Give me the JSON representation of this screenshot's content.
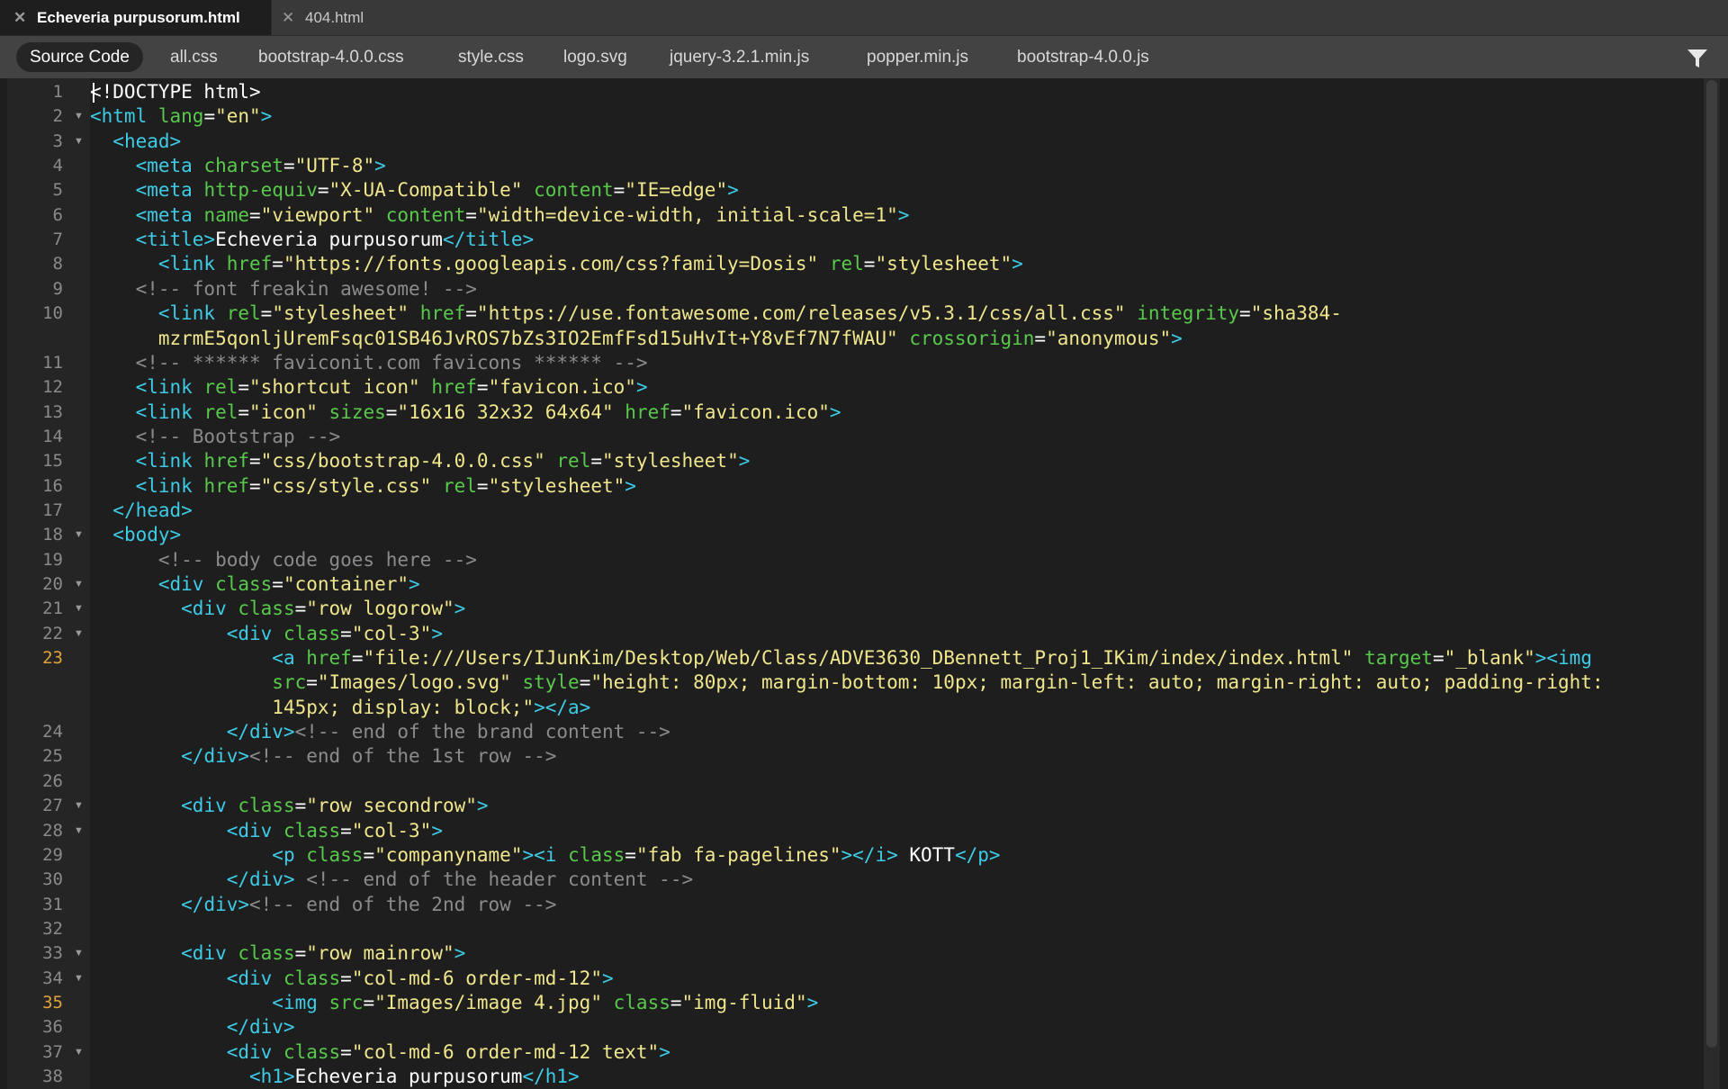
{
  "doc_tabs": [
    {
      "label": "Echeveria purpusorum.html",
      "active": true
    },
    {
      "label": "404.html",
      "active": false
    }
  ],
  "related_files": [
    "Source Code",
    "all.css",
    "bootstrap-4.0.0.css",
    "style.css",
    "logo.svg",
    "jquery-3.2.1.min.js",
    "popper.min.js",
    "bootstrap-4.0.0.js"
  ],
  "selected_file": "Source Code",
  "icons": {
    "close": "close-icon",
    "filter": "filter-icon",
    "fold": "fold-arrow-icon"
  },
  "colors": {
    "tag": "#3ecbe6",
    "attribute": "#59c94c",
    "value": "#f0e68c",
    "comment": "#8b8b8b",
    "text": "#ffffff",
    "highlight_line_number": "#e0a43b",
    "background": "#1e1e1e"
  },
  "highlighted_lines": [
    23,
    35
  ],
  "code_lines": [
    {
      "n": 1,
      "fold": false,
      "rows": [
        [
          [
            "t",
            "<!DOCTYPE html>"
          ]
        ]
      ]
    },
    {
      "n": 2,
      "fold": true,
      "rows": [
        [
          [
            "g",
            "<html "
          ],
          [
            "a",
            "lang"
          ],
          [
            "p",
            "="
          ],
          [
            "v",
            "\"en\""
          ],
          [
            "g",
            ">"
          ]
        ]
      ]
    },
    {
      "n": 3,
      "fold": true,
      "rows": [
        [
          [
            "t",
            "  "
          ],
          [
            "g",
            "<head>"
          ]
        ]
      ]
    },
    {
      "n": 4,
      "fold": false,
      "rows": [
        [
          [
            "t",
            "    "
          ],
          [
            "g",
            "<meta "
          ],
          [
            "a",
            "charset"
          ],
          [
            "p",
            "="
          ],
          [
            "v",
            "\"UTF-8\""
          ],
          [
            "g",
            ">"
          ]
        ]
      ]
    },
    {
      "n": 5,
      "fold": false,
      "rows": [
        [
          [
            "t",
            "    "
          ],
          [
            "g",
            "<meta "
          ],
          [
            "a",
            "http-equiv"
          ],
          [
            "p",
            "="
          ],
          [
            "v",
            "\"X-UA-Compatible\""
          ],
          [
            "t",
            " "
          ],
          [
            "a",
            "content"
          ],
          [
            "p",
            "="
          ],
          [
            "v",
            "\"IE=edge\""
          ],
          [
            "g",
            ">"
          ]
        ]
      ]
    },
    {
      "n": 6,
      "fold": false,
      "rows": [
        [
          [
            "t",
            "    "
          ],
          [
            "g",
            "<meta "
          ],
          [
            "a",
            "name"
          ],
          [
            "p",
            "="
          ],
          [
            "v",
            "\"viewport\""
          ],
          [
            "t",
            " "
          ],
          [
            "a",
            "content"
          ],
          [
            "p",
            "="
          ],
          [
            "v",
            "\"width=device-width, initial-scale=1\""
          ],
          [
            "g",
            ">"
          ]
        ]
      ]
    },
    {
      "n": 7,
      "fold": false,
      "rows": [
        [
          [
            "t",
            "    "
          ],
          [
            "g",
            "<title>"
          ],
          [
            "t",
            "Echeveria purpusorum"
          ],
          [
            "g",
            "</title>"
          ]
        ]
      ]
    },
    {
      "n": 8,
      "fold": false,
      "rows": [
        [
          [
            "t",
            "      "
          ],
          [
            "g",
            "<link "
          ],
          [
            "a",
            "href"
          ],
          [
            "p",
            "="
          ],
          [
            "v",
            "\"https://fonts.googleapis.com/css?family=Dosis\""
          ],
          [
            "t",
            " "
          ],
          [
            "a",
            "rel"
          ],
          [
            "p",
            "="
          ],
          [
            "v",
            "\"stylesheet\""
          ],
          [
            "g",
            ">"
          ]
        ]
      ]
    },
    {
      "n": 9,
      "fold": false,
      "rows": [
        [
          [
            "t",
            "    "
          ],
          [
            "c",
            "<!-- font freakin awesome! -->"
          ]
        ]
      ]
    },
    {
      "n": 10,
      "fold": false,
      "rows": [
        [
          [
            "t",
            "      "
          ],
          [
            "g",
            "<link "
          ],
          [
            "a",
            "rel"
          ],
          [
            "p",
            "="
          ],
          [
            "v",
            "\"stylesheet\""
          ],
          [
            "t",
            " "
          ],
          [
            "a",
            "href"
          ],
          [
            "p",
            "="
          ],
          [
            "v",
            "\"https://use.fontawesome.com/releases/v5.3.1/css/all.css\""
          ],
          [
            "t",
            " "
          ],
          [
            "a",
            "integrity"
          ],
          [
            "p",
            "="
          ],
          [
            "v",
            "\"sha384-"
          ]
        ],
        [
          [
            "t",
            "      "
          ],
          [
            "v",
            "mzrmE5qonljUremFsqc01SB46JvROS7bZs3IO2EmfFsd15uHvIt+Y8vEf7N7fWAU\""
          ],
          [
            "t",
            " "
          ],
          [
            "a",
            "crossorigin"
          ],
          [
            "p",
            "="
          ],
          [
            "v",
            "\"anonymous\""
          ],
          [
            "g",
            ">"
          ]
        ]
      ]
    },
    {
      "n": 11,
      "fold": false,
      "rows": [
        [
          [
            "t",
            "    "
          ],
          [
            "c",
            "<!-- ****** faviconit.com favicons ****** -->"
          ]
        ]
      ]
    },
    {
      "n": 12,
      "fold": false,
      "rows": [
        [
          [
            "t",
            "    "
          ],
          [
            "g",
            "<link "
          ],
          [
            "a",
            "rel"
          ],
          [
            "p",
            "="
          ],
          [
            "v",
            "\"shortcut icon\""
          ],
          [
            "t",
            " "
          ],
          [
            "a",
            "href"
          ],
          [
            "p",
            "="
          ],
          [
            "v",
            "\"favicon.ico\""
          ],
          [
            "g",
            ">"
          ]
        ]
      ]
    },
    {
      "n": 13,
      "fold": false,
      "rows": [
        [
          [
            "t",
            "    "
          ],
          [
            "g",
            "<link "
          ],
          [
            "a",
            "rel"
          ],
          [
            "p",
            "="
          ],
          [
            "v",
            "\"icon\""
          ],
          [
            "t",
            " "
          ],
          [
            "a",
            "sizes"
          ],
          [
            "p",
            "="
          ],
          [
            "v",
            "\"16x16 32x32 64x64\""
          ],
          [
            "t",
            " "
          ],
          [
            "a",
            "href"
          ],
          [
            "p",
            "="
          ],
          [
            "v",
            "\"favicon.ico\""
          ],
          [
            "g",
            ">"
          ]
        ]
      ]
    },
    {
      "n": 14,
      "fold": false,
      "rows": [
        [
          [
            "t",
            "    "
          ],
          [
            "c",
            "<!-- Bootstrap -->"
          ]
        ]
      ]
    },
    {
      "n": 15,
      "fold": false,
      "rows": [
        [
          [
            "t",
            "    "
          ],
          [
            "g",
            "<link "
          ],
          [
            "a",
            "href"
          ],
          [
            "p",
            "="
          ],
          [
            "v",
            "\"css/bootstrap-4.0.0.css\""
          ],
          [
            "t",
            " "
          ],
          [
            "a",
            "rel"
          ],
          [
            "p",
            "="
          ],
          [
            "v",
            "\"stylesheet\""
          ],
          [
            "g",
            ">"
          ]
        ]
      ]
    },
    {
      "n": 16,
      "fold": false,
      "rows": [
        [
          [
            "t",
            "    "
          ],
          [
            "g",
            "<link "
          ],
          [
            "a",
            "href"
          ],
          [
            "p",
            "="
          ],
          [
            "v",
            "\"css/style.css\""
          ],
          [
            "t",
            " "
          ],
          [
            "a",
            "rel"
          ],
          [
            "p",
            "="
          ],
          [
            "v",
            "\"stylesheet\""
          ],
          [
            "g",
            ">"
          ]
        ]
      ]
    },
    {
      "n": 17,
      "fold": false,
      "rows": [
        [
          [
            "t",
            "  "
          ],
          [
            "g",
            "</head>"
          ]
        ]
      ]
    },
    {
      "n": 18,
      "fold": true,
      "rows": [
        [
          [
            "t",
            "  "
          ],
          [
            "g",
            "<body>"
          ]
        ]
      ]
    },
    {
      "n": 19,
      "fold": false,
      "rows": [
        [
          [
            "t",
            "      "
          ],
          [
            "c",
            "<!-- body code goes here -->"
          ]
        ]
      ]
    },
    {
      "n": 20,
      "fold": true,
      "rows": [
        [
          [
            "t",
            "      "
          ],
          [
            "g",
            "<div "
          ],
          [
            "a",
            "class"
          ],
          [
            "p",
            "="
          ],
          [
            "v",
            "\"container\""
          ],
          [
            "g",
            ">"
          ]
        ]
      ]
    },
    {
      "n": 21,
      "fold": true,
      "rows": [
        [
          [
            "t",
            "        "
          ],
          [
            "g",
            "<div "
          ],
          [
            "a",
            "class"
          ],
          [
            "p",
            "="
          ],
          [
            "v",
            "\"row logorow\""
          ],
          [
            "g",
            ">"
          ]
        ]
      ]
    },
    {
      "n": 22,
      "fold": true,
      "rows": [
        [
          [
            "t",
            "            "
          ],
          [
            "g",
            "<div "
          ],
          [
            "a",
            "class"
          ],
          [
            "p",
            "="
          ],
          [
            "v",
            "\"col-3\""
          ],
          [
            "g",
            ">"
          ]
        ]
      ]
    },
    {
      "n": 23,
      "fold": false,
      "rows": [
        [
          [
            "t",
            "                "
          ],
          [
            "g",
            "<a "
          ],
          [
            "a",
            "href"
          ],
          [
            "p",
            "="
          ],
          [
            "v",
            "\"file:///Users/IJunKim/Desktop/Web/Class/ADVE3630_DBennett_Proj1_IKim/index/index.html\""
          ],
          [
            "t",
            " "
          ],
          [
            "a",
            "target"
          ],
          [
            "p",
            "="
          ],
          [
            "v",
            "\"_blank\""
          ],
          [
            "g",
            "><img"
          ]
        ],
        [
          [
            "t",
            "                "
          ],
          [
            "a",
            "src"
          ],
          [
            "p",
            "="
          ],
          [
            "v",
            "\"Images/logo.svg\""
          ],
          [
            "t",
            " "
          ],
          [
            "a",
            "style"
          ],
          [
            "p",
            "="
          ],
          [
            "v",
            "\"height: 80px; margin-bottom: 10px; margin-left: auto; margin-right: auto; padding-right:"
          ]
        ],
        [
          [
            "t",
            "                "
          ],
          [
            "v",
            "145px; display: block;\""
          ],
          [
            "g",
            "></a>"
          ]
        ]
      ]
    },
    {
      "n": 24,
      "fold": false,
      "rows": [
        [
          [
            "t",
            "            "
          ],
          [
            "g",
            "</div>"
          ],
          [
            "c",
            "<!-- end of the brand content -->"
          ]
        ]
      ]
    },
    {
      "n": 25,
      "fold": false,
      "rows": [
        [
          [
            "t",
            "        "
          ],
          [
            "g",
            "</div>"
          ],
          [
            "c",
            "<!-- end of the 1st row -->"
          ]
        ]
      ]
    },
    {
      "n": 26,
      "fold": false,
      "rows": [
        [
          [
            "t",
            ""
          ]
        ]
      ]
    },
    {
      "n": 27,
      "fold": true,
      "rows": [
        [
          [
            "t",
            "        "
          ],
          [
            "g",
            "<div "
          ],
          [
            "a",
            "class"
          ],
          [
            "p",
            "="
          ],
          [
            "v",
            "\"row secondrow\""
          ],
          [
            "g",
            ">"
          ]
        ]
      ]
    },
    {
      "n": 28,
      "fold": true,
      "rows": [
        [
          [
            "t",
            "            "
          ],
          [
            "g",
            "<div "
          ],
          [
            "a",
            "class"
          ],
          [
            "p",
            "="
          ],
          [
            "v",
            "\"col-3\""
          ],
          [
            "g",
            ">"
          ]
        ]
      ]
    },
    {
      "n": 29,
      "fold": false,
      "rows": [
        [
          [
            "t",
            "                "
          ],
          [
            "g",
            "<p "
          ],
          [
            "a",
            "class"
          ],
          [
            "p",
            "="
          ],
          [
            "v",
            "\"companyname\""
          ],
          [
            "g",
            "><i "
          ],
          [
            "a",
            "class"
          ],
          [
            "p",
            "="
          ],
          [
            "v",
            "\"fab fa-pagelines\""
          ],
          [
            "g",
            "></i>"
          ],
          [
            "t",
            " KOTT"
          ],
          [
            "g",
            "</p>"
          ]
        ]
      ]
    },
    {
      "n": 30,
      "fold": false,
      "rows": [
        [
          [
            "t",
            "            "
          ],
          [
            "g",
            "</div>"
          ],
          [
            "t",
            " "
          ],
          [
            "c",
            "<!-- end of the header content -->"
          ]
        ]
      ]
    },
    {
      "n": 31,
      "fold": false,
      "rows": [
        [
          [
            "t",
            "        "
          ],
          [
            "g",
            "</div>"
          ],
          [
            "c",
            "<!-- end of the 2nd row -->"
          ]
        ]
      ]
    },
    {
      "n": 32,
      "fold": false,
      "rows": [
        [
          [
            "t",
            ""
          ]
        ]
      ]
    },
    {
      "n": 33,
      "fold": true,
      "rows": [
        [
          [
            "t",
            "        "
          ],
          [
            "g",
            "<div "
          ],
          [
            "a",
            "class"
          ],
          [
            "p",
            "="
          ],
          [
            "v",
            "\"row mainrow\""
          ],
          [
            "g",
            ">"
          ]
        ]
      ]
    },
    {
      "n": 34,
      "fold": true,
      "rows": [
        [
          [
            "t",
            "            "
          ],
          [
            "g",
            "<div "
          ],
          [
            "a",
            "class"
          ],
          [
            "p",
            "="
          ],
          [
            "v",
            "\"col-md-6 order-md-12\""
          ],
          [
            "g",
            ">"
          ]
        ]
      ]
    },
    {
      "n": 35,
      "fold": false,
      "rows": [
        [
          [
            "t",
            "                "
          ],
          [
            "g",
            "<img "
          ],
          [
            "a",
            "src"
          ],
          [
            "p",
            "="
          ],
          [
            "v",
            "\"Images/image 4.jpg\""
          ],
          [
            "t",
            " "
          ],
          [
            "a",
            "class"
          ],
          [
            "p",
            "="
          ],
          [
            "v",
            "\"img-fluid\""
          ],
          [
            "g",
            ">"
          ]
        ]
      ]
    },
    {
      "n": 36,
      "fold": false,
      "rows": [
        [
          [
            "t",
            "            "
          ],
          [
            "g",
            "</div>"
          ]
        ]
      ]
    },
    {
      "n": 37,
      "fold": true,
      "rows": [
        [
          [
            "t",
            "            "
          ],
          [
            "g",
            "<div "
          ],
          [
            "a",
            "class"
          ],
          [
            "p",
            "="
          ],
          [
            "v",
            "\"col-md-6 order-md-12 text\""
          ],
          [
            "g",
            ">"
          ]
        ]
      ]
    },
    {
      "n": 38,
      "fold": false,
      "rows": [
        [
          [
            "t",
            "              "
          ],
          [
            "g",
            "<h1>"
          ],
          [
            "t",
            "Echeveria purpusorum"
          ],
          [
            "g",
            "</h1>"
          ]
        ]
      ]
    }
  ]
}
